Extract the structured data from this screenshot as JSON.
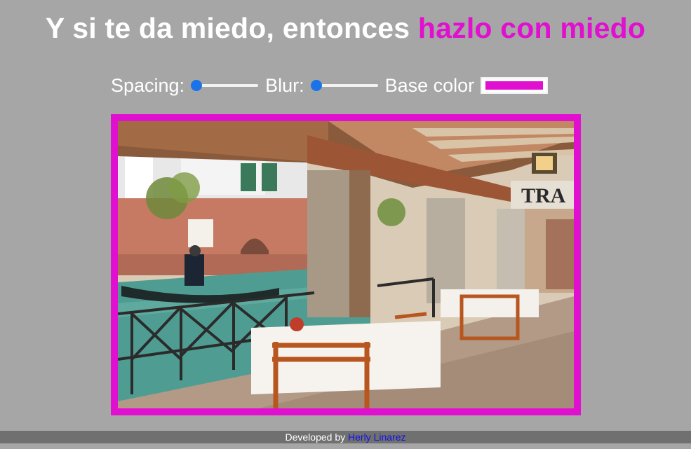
{
  "header": {
    "title_plain": "Y si te da miedo, entonces",
    "title_highlight": "hazlo con miedo"
  },
  "controls": {
    "spacing_label": "Spacing:",
    "spacing_value": 0,
    "blur_label": "Blur:",
    "blur_value": 0,
    "base_color_label": "Base color",
    "base_color_value": "#e10fcf"
  },
  "image": {
    "border_color": "#e10fcf",
    "sign_text": "TRA"
  },
  "footer": {
    "developed_by": "Developed by",
    "author_link": "Herly Linarez"
  }
}
